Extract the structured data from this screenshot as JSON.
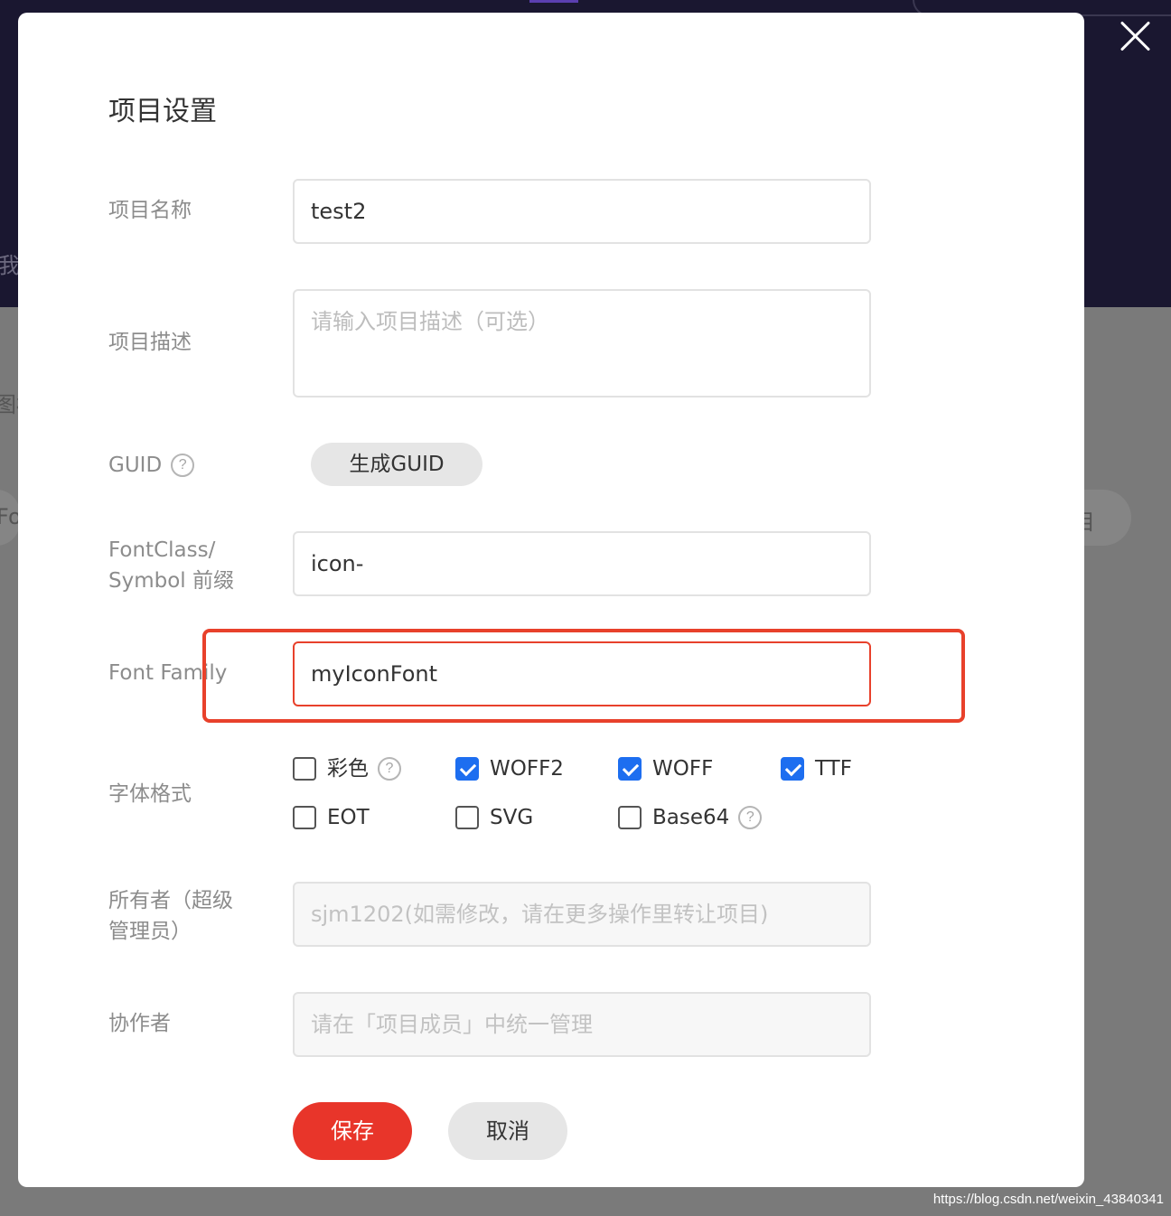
{
  "background": {
    "fragments": [
      "我",
      "图标",
      "Fo",
      "目"
    ]
  },
  "watermark": "https://blog.csdn.net/weixin_43840341",
  "dialog": {
    "title": "项目设置",
    "fields": {
      "name": {
        "label": "项目名称",
        "value": "test2"
      },
      "description": {
        "label": "项目描述",
        "placeholder": "请输入项目描述（可选）"
      },
      "guid": {
        "label": "GUID",
        "button": "生成GUID"
      },
      "prefix": {
        "label_line1": "FontClass/",
        "label_line2": "Symbol 前缀",
        "value": "icon-"
      },
      "font_family": {
        "label": "Font Family",
        "value": "myIconFont"
      },
      "formats": {
        "label": "字体格式",
        "options": [
          {
            "label": "彩色",
            "checked": false
          },
          {
            "label": "WOFF2",
            "checked": true
          },
          {
            "label": "WOFF",
            "checked": true
          },
          {
            "label": "TTF",
            "checked": true
          },
          {
            "label": "EOT",
            "checked": false
          },
          {
            "label": "SVG",
            "checked": false
          },
          {
            "label": "Base64",
            "checked": false
          }
        ]
      },
      "owner": {
        "label_line1": "所有者（超级",
        "label_line2": "管理员）",
        "value": "sjm1202(如需修改，请在更多操作里转让项目)"
      },
      "collaborators": {
        "label": "协作者",
        "placeholder": "请在「项目成员」中统一管理"
      }
    },
    "buttons": {
      "save": "保存",
      "cancel": "取消"
    },
    "help_glyph": "?"
  },
  "colors": {
    "accent": "#e8352a",
    "checkbox": "#1d6ef0",
    "highlight": "#e8412b"
  }
}
